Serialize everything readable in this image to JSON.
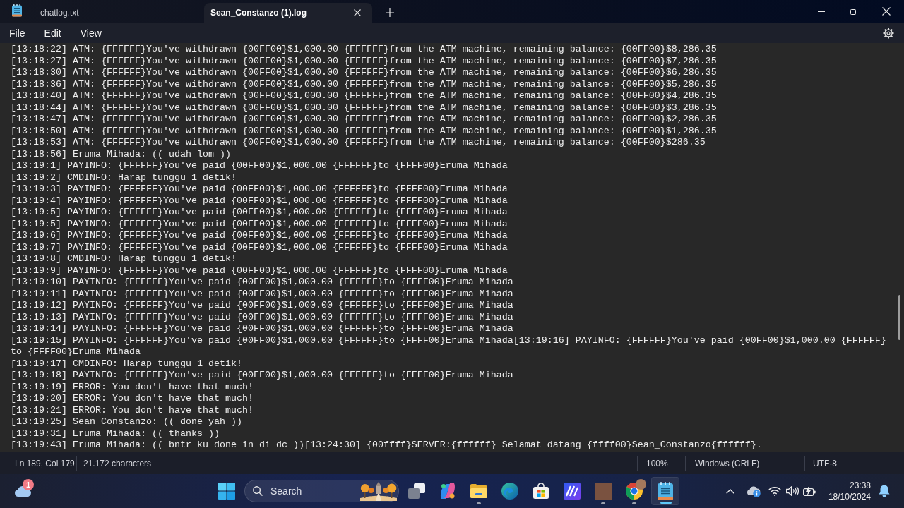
{
  "window": {
    "tabs": [
      {
        "label": "chatlog.txt",
        "selected": false
      },
      {
        "label": "Sean_Constanzo (1).log",
        "selected": true
      }
    ]
  },
  "menu": [
    "File",
    "Edit",
    "View"
  ],
  "editor": {
    "lines": [
      "[13:18:22] ATM: {FFFFFF}You've withdrawn {00FF00}$1,000.00 {FFFFFF}from the ATM machine, remaining balance: {00FF00}$8,286.35",
      "[13:18:27] ATM: {FFFFFF}You've withdrawn {00FF00}$1,000.00 {FFFFFF}from the ATM machine, remaining balance: {00FF00}$7,286.35",
      "[13:18:30] ATM: {FFFFFF}You've withdrawn {00FF00}$1,000.00 {FFFFFF}from the ATM machine, remaining balance: {00FF00}$6,286.35",
      "[13:18:36] ATM: {FFFFFF}You've withdrawn {00FF00}$1,000.00 {FFFFFF}from the ATM machine, remaining balance: {00FF00}$5,286.35",
      "[13:18:40] ATM: {FFFFFF}You've withdrawn {00FF00}$1,000.00 {FFFFFF}from the ATM machine, remaining balance: {00FF00}$4,286.35",
      "[13:18:44] ATM: {FFFFFF}You've withdrawn {00FF00}$1,000.00 {FFFFFF}from the ATM machine, remaining balance: {00FF00}$3,286.35",
      "[13:18:47] ATM: {FFFFFF}You've withdrawn {00FF00}$1,000.00 {FFFFFF}from the ATM machine, remaining balance: {00FF00}$2,286.35",
      "[13:18:50] ATM: {FFFFFF}You've withdrawn {00FF00}$1,000.00 {FFFFFF}from the ATM machine, remaining balance: {00FF00}$1,286.35",
      "[13:18:53] ATM: {FFFFFF}You've withdrawn {00FF00}$1,000.00 {FFFFFF}from the ATM machine, remaining balance: {00FF00}$286.35",
      "[13:18:56] Eruma Mihada: (( udah lom ))",
      "[13:19:1] PAYINFO: {FFFFFF}You've paid {00FF00}$1,000.00 {FFFFFF}to {FFFF00}Eruma Mihada",
      "[13:19:2] CMDINFO: Harap tunggu 1 detik!",
      "[13:19:3] PAYINFO: {FFFFFF}You've paid {00FF00}$1,000.00 {FFFFFF}to {FFFF00}Eruma Mihada",
      "[13:19:4] PAYINFO: {FFFFFF}You've paid {00FF00}$1,000.00 {FFFFFF}to {FFFF00}Eruma Mihada",
      "[13:19:5] PAYINFO: {FFFFFF}You've paid {00FF00}$1,000.00 {FFFFFF}to {FFFF00}Eruma Mihada",
      "[13:19:5] PAYINFO: {FFFFFF}You've paid {00FF00}$1,000.00 {FFFFFF}to {FFFF00}Eruma Mihada",
      "[13:19:6] PAYINFO: {FFFFFF}You've paid {00FF00}$1,000.00 {FFFFFF}to {FFFF00}Eruma Mihada",
      "[13:19:7] PAYINFO: {FFFFFF}You've paid {00FF00}$1,000.00 {FFFFFF}to {FFFF00}Eruma Mihada",
      "[13:19:8] CMDINFO: Harap tunggu 1 detik!",
      "[13:19:9] PAYINFO: {FFFFFF}You've paid {00FF00}$1,000.00 {FFFFFF}to {FFFF00}Eruma Mihada",
      "[13:19:10] PAYINFO: {FFFFFF}You've paid {00FF00}$1,000.00 {FFFFFF}to {FFFF00}Eruma Mihada",
      "[13:19:11] PAYINFO: {FFFFFF}You've paid {00FF00}$1,000.00 {FFFFFF}to {FFFF00}Eruma Mihada",
      "[13:19:12] PAYINFO: {FFFFFF}You've paid {00FF00}$1,000.00 {FFFFFF}to {FFFF00}Eruma Mihada",
      "[13:19:13] PAYINFO: {FFFFFF}You've paid {00FF00}$1,000.00 {FFFFFF}to {FFFF00}Eruma Mihada",
      "[13:19:14] PAYINFO: {FFFFFF}You've paid {00FF00}$1,000.00 {FFFFFF}to {FFFF00}Eruma Mihada",
      "[13:19:15] PAYINFO: {FFFFFF}You've paid {00FF00}$1,000.00 {FFFFFF}to {FFFF00}Eruma Mihada[13:19:16] PAYINFO: {FFFFFF}You've paid {00FF00}$1,000.00 {FFFFFF} to {FFFF00}Eruma Mihada",
      "[13:19:17] CMDINFO: Harap tunggu 1 detik!",
      "[13:19:18] PAYINFO: {FFFFFF}You've paid {00FF00}$1,000.00 {FFFFFF}to {FFFF00}Eruma Mihada",
      "[13:19:19] ERROR: You don't have that much!",
      "[13:19:20] ERROR: You don't have that much!",
      "[13:19:21] ERROR: You don't have that much!",
      "[13:19:25] Sean Constanzo: (( done yah ))",
      "[13:19:31] Eruma Mihada: (( thanks ))",
      "[13:19:43] Eruma Mihada: (( bntr ku done in di dc ))[13:24:30] {00ffff}SERVER:{ffffff} Selamat datang {ffff00}Sean_Constanzo{ffffff}."
    ]
  },
  "status_bar": {
    "position": "Ln 189, Col 179",
    "characters": "21.172 characters",
    "zoom": "100%",
    "line_ending": "Windows (CRLF)",
    "encoding": "UTF-8"
  },
  "taskbar": {
    "weather_badge": "1",
    "search": {
      "placeholder": "Search"
    },
    "apps": [
      {
        "kind": "task_view",
        "running": false,
        "selected": false
      },
      {
        "kind": "swirl",
        "running": false,
        "selected": false
      },
      {
        "kind": "folder",
        "running": true,
        "selected": false
      },
      {
        "kind": "wave_browser",
        "running": false,
        "selected": false
      },
      {
        "kind": "store",
        "running": false,
        "selected": false
      },
      {
        "kind": "slash_tile",
        "running": false,
        "selected": false
      },
      {
        "kind": "photo_tile",
        "running": true,
        "selected": false
      },
      {
        "kind": "tricolor_browser",
        "running": true,
        "selected": false
      },
      {
        "kind": "notepad",
        "running": true,
        "selected": true
      }
    ],
    "clock": {
      "time": "23:38",
      "date": "18/10/2024"
    }
  }
}
